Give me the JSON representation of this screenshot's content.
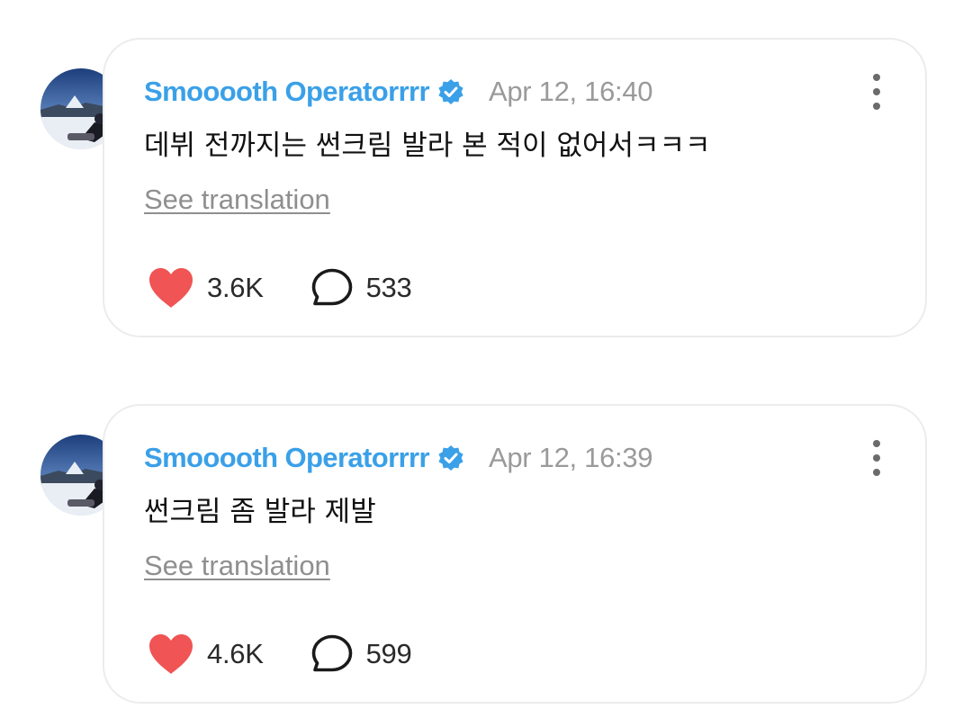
{
  "posts": [
    {
      "username": "Smooooth Operatorrrr",
      "verified": true,
      "timestamp": "Apr 12, 16:40",
      "text": "데뷔 전까지는 썬크림 발라 본 적이 없어서ㅋㅋㅋ",
      "translate_label": "See translation",
      "likes": "3.6K",
      "comments": "533"
    },
    {
      "username": "Smooooth Operatorrrr",
      "verified": true,
      "timestamp": "Apr 12, 16:39",
      "text": "썬크림 좀 발라 제발",
      "translate_label": "See translation",
      "likes": "4.6K",
      "comments": "599"
    }
  ],
  "icons": {
    "like": "heart-icon",
    "comment": "comment-bubble-icon",
    "menu": "more-vertical-icon",
    "badge": "verified-badge-icon"
  },
  "colors": {
    "username": "#3aa0e8",
    "verified_badge": "#3aa0e8",
    "heart": "#f05454",
    "timestamp": "#9a9a9a",
    "translate_link": "#8f8f8f"
  }
}
